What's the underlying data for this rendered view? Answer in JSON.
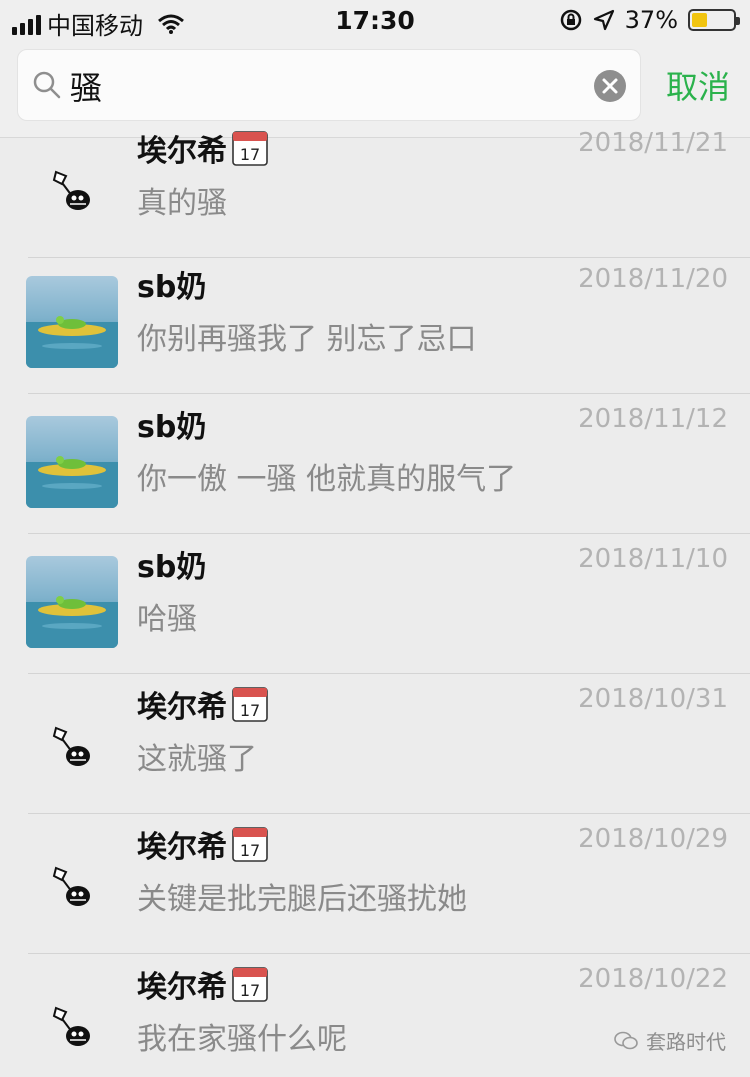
{
  "status_bar": {
    "carrier": "中国移动",
    "time": "17:30",
    "battery_percent_text": "37%",
    "battery_level": 0.37,
    "battery_color": "#f1c40f"
  },
  "search": {
    "query": "骚",
    "placeholder": "",
    "cancel_label": "取消",
    "accent_color": "#2bb24c"
  },
  "results": [
    {
      "name": "埃尔希",
      "has_calendar_icon": true,
      "avatar": "skull-avatar",
      "date": "2018/11/21",
      "message": "真的骚"
    },
    {
      "name": "sb奶",
      "has_calendar_icon": false,
      "avatar": "frog-float-avatar",
      "date": "2018/11/20",
      "message": "你别再骚我了 别忘了忌口"
    },
    {
      "name": "sb奶",
      "has_calendar_icon": false,
      "avatar": "frog-float-avatar",
      "date": "2018/11/12",
      "message": "你一傲 一骚 他就真的服气了"
    },
    {
      "name": "sb奶",
      "has_calendar_icon": false,
      "avatar": "frog-float-avatar",
      "date": "2018/11/10",
      "message": "哈骚"
    },
    {
      "name": "埃尔希",
      "has_calendar_icon": true,
      "avatar": "skull-avatar",
      "date": "2018/10/31",
      "message": "这就骚了"
    },
    {
      "name": "埃尔希",
      "has_calendar_icon": true,
      "avatar": "skull-avatar",
      "date": "2018/10/29",
      "message": "关键是批完腿后还骚扰她"
    },
    {
      "name": "埃尔希",
      "has_calendar_icon": true,
      "avatar": "skull-avatar",
      "date": "2018/10/22",
      "message": "我在家骚什么呢"
    }
  ],
  "calendar_icon_text": "17",
  "watermark": {
    "text": "套路时代"
  }
}
